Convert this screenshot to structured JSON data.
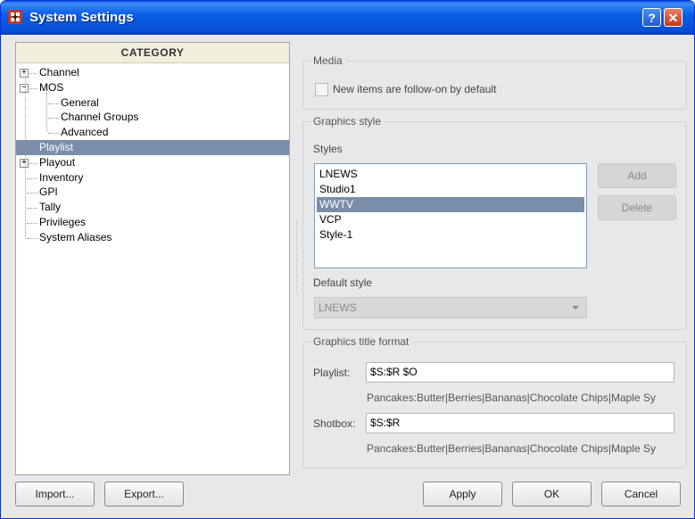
{
  "window": {
    "title": "System Settings",
    "help_glyph": "?",
    "close_glyph": "✕"
  },
  "category": {
    "header": "CATEGORY",
    "items": [
      {
        "label": "Channel",
        "level": 0,
        "expander": "+"
      },
      {
        "label": "MOS",
        "level": 0,
        "expander": "−"
      },
      {
        "label": "General",
        "level": 1
      },
      {
        "label": "Channel Groups",
        "level": 1
      },
      {
        "label": "Advanced",
        "level": 1
      },
      {
        "label": "Playlist",
        "level": 0,
        "selected": true
      },
      {
        "label": "Playout",
        "level": 0,
        "expander": "+"
      },
      {
        "label": "Inventory",
        "level": 0
      },
      {
        "label": "GPI",
        "level": 0
      },
      {
        "label": "Tally",
        "level": 0
      },
      {
        "label": "Privileges",
        "level": 0
      },
      {
        "label": "System Aliases",
        "level": 0
      }
    ]
  },
  "media": {
    "title": "Media",
    "follow_on_label": "New items are follow-on by default",
    "follow_on_checked": false
  },
  "graphics_style": {
    "title": "Graphics style",
    "styles_label": "Styles",
    "styles": [
      "LNEWS",
      "Studio1",
      "WWTV",
      "VCP",
      "Style-1"
    ],
    "selected_style": "WWTV",
    "add_label": "Add",
    "delete_label": "Delete",
    "default_style_label": "Default style",
    "default_style_value": "LNEWS"
  },
  "title_format": {
    "title": "Graphics title format",
    "playlist_label": "Playlist:",
    "playlist_value": "$S:$R $O",
    "playlist_hint": "Pancakes:Butter|Berries|Bananas|Chocolate Chips|Maple Sy",
    "shotbox_label": "Shotbox:",
    "shotbox_value": "$S:$R",
    "shotbox_hint": "Pancakes:Butter|Berries|Bananas|Chocolate Chips|Maple Sy"
  },
  "footer": {
    "import_label": "Import...",
    "export_label": "Export...",
    "apply_label": "Apply",
    "ok_label": "OK",
    "cancel_label": "Cancel"
  }
}
